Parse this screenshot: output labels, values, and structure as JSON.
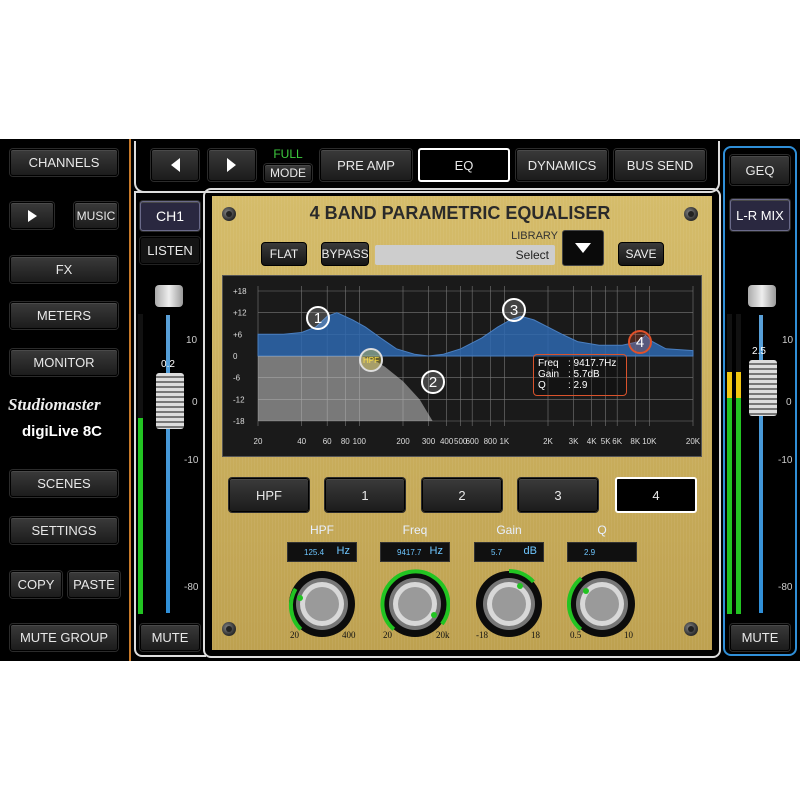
{
  "left_panel": {
    "channels": "CHANNELS",
    "music": "MUSIC",
    "fx": "FX",
    "meters": "METERS",
    "monitor": "MONITOR",
    "brand": "Studiomaster",
    "brand_model": "digiLive 8C",
    "scenes": "SCENES",
    "settings": "SETTINGS",
    "copy": "COPY",
    "paste": "PASTE",
    "mute_group": "MUTE GROUP"
  },
  "top_bar": {
    "full": "FULL",
    "mode": "MODE",
    "tabs": [
      "PRE AMP",
      "EQ",
      "DYNAMICS",
      "BUS SEND"
    ],
    "selected_tab": "EQ"
  },
  "channel_strip": {
    "name": "CH1",
    "listen": "LISTEN",
    "fader_value": "0.2",
    "mute": "MUTE",
    "scale": [
      "10",
      "0",
      "-10",
      "-80"
    ]
  },
  "right_strip": {
    "geq": "GEQ",
    "name": "L-R MIX",
    "fader_value": "2.5",
    "mute": "MUTE",
    "scale": [
      "10",
      "0",
      "-10",
      "-80"
    ]
  },
  "eq_panel": {
    "title": "4 BAND PARAMETRIC EQUALISER",
    "flat": "FLAT",
    "bypass": "BYPASS",
    "library_label": "LIBRARY",
    "library_value": "Select",
    "save": "SAVE",
    "graph": {
      "y_ticks": [
        "+18",
        "+12",
        "+6",
        "0",
        "-6",
        "-12",
        "-18"
      ],
      "x_ticks": [
        "20",
        "40",
        "60",
        "80",
        "100",
        "200",
        "300",
        "400",
        "500",
        "600",
        "800",
        "1K",
        "2K",
        "3K",
        "4K",
        "5K",
        "6K",
        "8K",
        "10K",
        "20K"
      ],
      "nodes": [
        "1",
        "HPF",
        "2",
        "3",
        "4"
      ],
      "readout": {
        "freq_label": "Freq",
        "freq_value": ": 9417.7Hz",
        "gain_label": "Gain",
        "gain_value": ": 5.7dB",
        "q_label": "Q",
        "q_value": ": 2.9"
      }
    },
    "bands": [
      "HPF",
      "1",
      "2",
      "3",
      "4"
    ],
    "selected_band": "4",
    "params": [
      {
        "label": "HPF",
        "value": "125.4",
        "unit": "Hz",
        "min": "20",
        "max": "400"
      },
      {
        "label": "Freq",
        "value": "9417.7",
        "unit": "Hz",
        "min": "20",
        "max": "20k"
      },
      {
        "label": "Gain",
        "value": "5.7",
        "unit": "dB",
        "min": "-18",
        "max": "18"
      },
      {
        "label": "Q",
        "value": "2.9",
        "unit": "",
        "min": "0.5",
        "max": "10"
      }
    ]
  },
  "colors": {
    "accent_blue": "#2f8fd8",
    "meter_green": "#22c422",
    "gold": "#c8ae5c",
    "orange_divider": "#c87a2a"
  }
}
